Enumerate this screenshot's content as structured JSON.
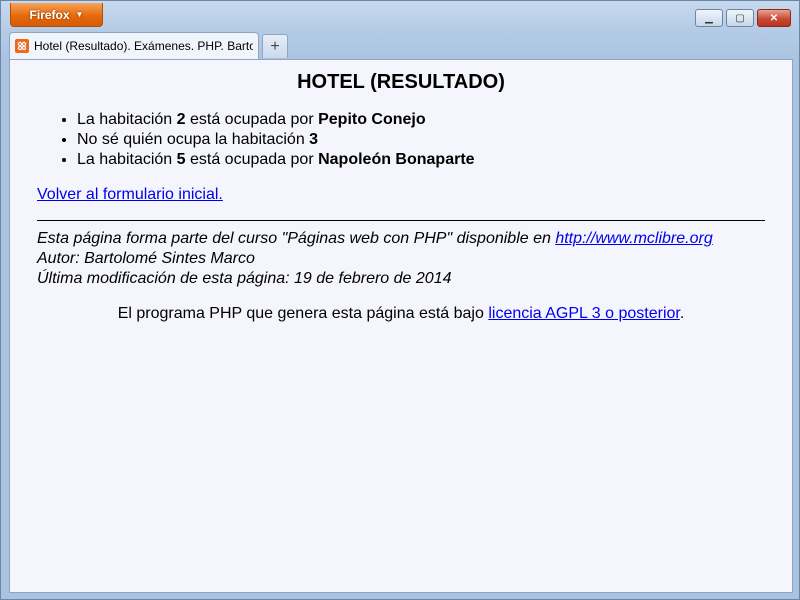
{
  "browser": {
    "menu_label": "Firefox",
    "menu_arrow": "▼",
    "tab_title": "Hotel (Resultado). Exámenes. PHP. Barto...",
    "newtab_label": "+",
    "controls": {
      "minimize": "▁",
      "maximize": "▢",
      "close": "✕"
    }
  },
  "page": {
    "title": "HOTEL (RESULTADO)",
    "items": [
      {
        "pre": "La habitación ",
        "num": "2",
        "mid": " está ocupada por ",
        "name": "Pepito Conejo"
      },
      {
        "pre": "No sé quién ocupa la habitación ",
        "num": "3"
      },
      {
        "pre": "La habitación ",
        "num": "5",
        "mid": " está ocupada por ",
        "name": "Napoleón Bonaparte"
      }
    ],
    "back_link": "Volver al formulario inicial.",
    "footer": {
      "course_text": "Esta página forma parte del curso \"Páginas web con PHP\" disponible en ",
      "course_link": "http://www.mclibre.org",
      "author": "Autor: Bartolomé Sintes Marco",
      "modified": "Última modificación de esta página: 19 de febrero de 2014"
    },
    "license": {
      "text": "El programa PHP que genera esta página está bajo ",
      "link": "licencia AGPL 3 o posterior",
      "end": "."
    }
  }
}
